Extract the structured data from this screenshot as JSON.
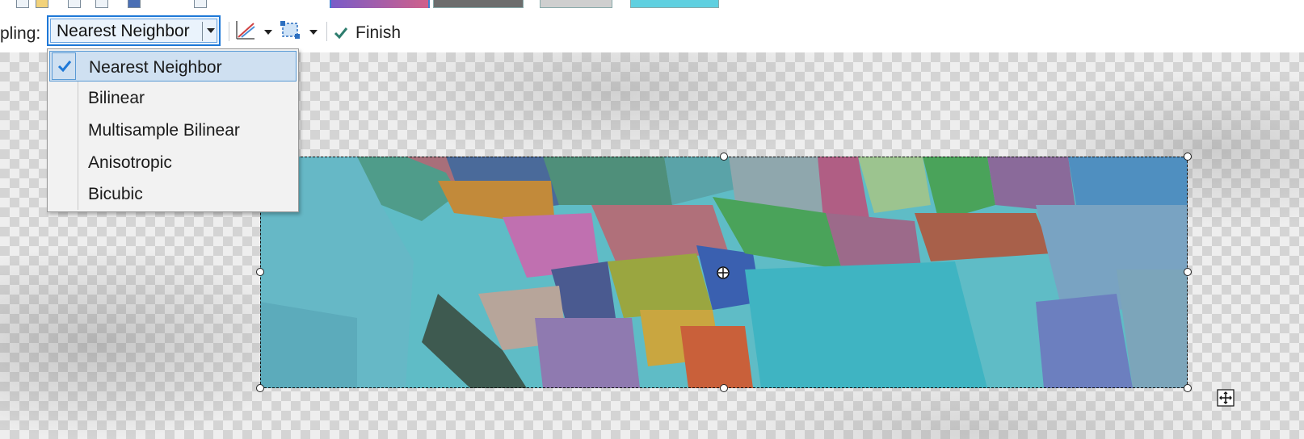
{
  "toolbar": {
    "resampling_label": "pling:",
    "resampling_value": "Nearest Neighbor",
    "finish_label": "Finish"
  },
  "resampling_menu": {
    "items": [
      {
        "label": "Nearest Neighbor",
        "checked": true
      },
      {
        "label": "Bilinear",
        "checked": false
      },
      {
        "label": "Multisample Bilinear",
        "checked": false
      },
      {
        "label": "Anisotropic",
        "checked": false
      },
      {
        "label": "Bicubic",
        "checked": false
      }
    ]
  },
  "icons": {
    "check": "check-icon",
    "line_symbology": "line-chart-icon",
    "extent": "extent-icon",
    "move": "move-icon",
    "pivot": "pivot-icon"
  },
  "colors": {
    "accent": "#1e78d7",
    "finish_check": "#2e7d6e",
    "menu_selected_bg": "#cfe0f1"
  }
}
